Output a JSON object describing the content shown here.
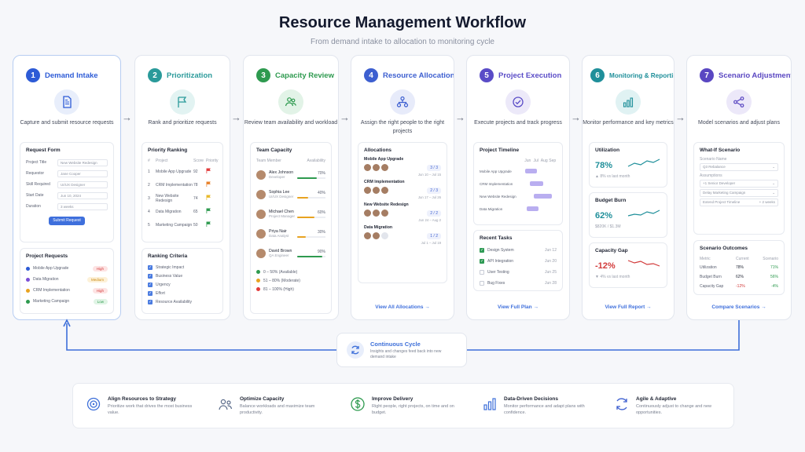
{
  "header": {
    "title": "Resource Management Workflow",
    "subtitle": "From demand intake to allocation to monitoring cycle"
  },
  "stages": [
    {
      "num": "1",
      "title": "Demand Intake",
      "color": "#2d5bd6",
      "desc": "Capture and submit resource requests"
    },
    {
      "num": "2",
      "title": "Prioritization",
      "color": "#2a9a9a",
      "desc": "Rank and prioritize requests"
    },
    {
      "num": "3",
      "title": "Capacity Review",
      "color": "#2e9a4f",
      "desc": "Review team availability and workload"
    },
    {
      "num": "4",
      "title": "Resource Allocation",
      "color": "#3d5fd0",
      "desc": "Assign the right people to the right projects"
    },
    {
      "num": "5",
      "title": "Project Execution",
      "color": "#5a4cc7",
      "desc": "Execute projects and track progress"
    },
    {
      "num": "6",
      "title": "Monitoring & Reporting",
      "color": "#1f8f9a",
      "desc": "Monitor performance and key metrics"
    },
    {
      "num": "7",
      "title": "Scenario Adjustments",
      "color": "#5a47c2",
      "desc": "Model scenarios and adjust plans"
    }
  ],
  "intake": {
    "form_title": "Request Form",
    "fields": [
      {
        "label": "Project Title",
        "value": "New Website Redesign"
      },
      {
        "label": "Requestor",
        "value": "Jane Cooper"
      },
      {
        "label": "Skill Required",
        "value": "UI/UX Designer"
      },
      {
        "label": "Start Date",
        "value": "Jun 10, 2024"
      },
      {
        "label": "Duration",
        "value": "3 weeks"
      }
    ],
    "submit": "Submit Request",
    "requests_title": "Project Requests",
    "requests": [
      {
        "name": "Mobile App Upgrade",
        "dot": "#2d5bd6",
        "tag": "High",
        "tag_bg": "#fde3e3",
        "tag_fg": "#d23a3a"
      },
      {
        "name": "Data Migration",
        "dot": "#7a4fd6",
        "tag": "Medium",
        "tag_bg": "#fdf1d8",
        "tag_fg": "#c98a12"
      },
      {
        "name": "CRM Implementation",
        "dot": "#e8a320",
        "tag": "High",
        "tag_bg": "#fde3e3",
        "tag_fg": "#d23a3a"
      },
      {
        "name": "Marketing Campaign",
        "dot": "#2e9a4f",
        "tag": "Low",
        "tag_bg": "#e0f4e5",
        "tag_fg": "#2e9a4f"
      }
    ]
  },
  "priority": {
    "title": "Priority Ranking",
    "headers": [
      "#",
      "Project",
      "Score",
      "Priority"
    ],
    "rows": [
      {
        "rank": "1",
        "project": "Mobile App Upgrade",
        "score": "92",
        "flag": "#e23b3b"
      },
      {
        "rank": "2",
        "project": "CRM Implementation",
        "score": "78",
        "flag": "#e8812a"
      },
      {
        "rank": "3",
        "project": "New Website Redesign",
        "score": "74",
        "flag": "#e8b92a"
      },
      {
        "rank": "4",
        "project": "Data Migration",
        "score": "65",
        "flag": "#2e9a4f"
      },
      {
        "rank": "5",
        "project": "Marketing Campaign",
        "score": "50",
        "flag": "#2e9a4f"
      }
    ],
    "criteria_title": "Ranking Criteria",
    "criteria": [
      "Strategic Impact",
      "Business Value",
      "Urgency",
      "Effort",
      "Resource Availability"
    ]
  },
  "capacity": {
    "title": "Team Capacity",
    "headers": [
      "Team Member",
      "Availability"
    ],
    "members": [
      {
        "name": "Alex Johnson",
        "role": "Developer",
        "pct": "70%",
        "fill": 0.7,
        "color": "#2e9a4f"
      },
      {
        "name": "Sophia Lee",
        "role": "UI/UX Designer",
        "pct": "40%",
        "fill": 0.4,
        "color": "#e8a320"
      },
      {
        "name": "Michael Chen",
        "role": "Project Manager",
        "pct": "60%",
        "fill": 0.6,
        "color": "#e8a320"
      },
      {
        "name": "Priya Nair",
        "role": "Data Analyst",
        "pct": "30%",
        "fill": 0.3,
        "color": "#e8a320"
      },
      {
        "name": "David Brown",
        "role": "QA Engineer",
        "pct": "90%",
        "fill": 0.9,
        "color": "#2e9a4f"
      }
    ],
    "legend": [
      {
        "label": "0 – 50% (Available)",
        "color": "#2e9a4f"
      },
      {
        "label": "51 – 80% (Moderate)",
        "color": "#e8a320"
      },
      {
        "label": "81 – 100% (High)",
        "color": "#e23b3b"
      }
    ]
  },
  "allocation": {
    "title": "Allocations",
    "items": [
      {
        "name": "Mobile App Upgrade",
        "count": "3 / 3",
        "dates": "Jun 10 – Jul 15"
      },
      {
        "name": "CRM Implementation",
        "count": "2 / 3",
        "dates": "Jun 17 – Jul 26"
      },
      {
        "name": "New Website Redesign",
        "count": "2 / 2",
        "dates": "Jun 24 – Aug 2"
      },
      {
        "name": "Data Migration",
        "count": "1 / 2",
        "dates": "Jul 1 – Jul 19"
      }
    ],
    "link": "View All Allocations →"
  },
  "execution": {
    "timeline_title": "Project Timeline",
    "months": [
      "Jun",
      "Jul",
      "Aug",
      "Sep"
    ],
    "tasks_gantt": [
      {
        "name": "Mobile App Upgrade",
        "start": 0.05,
        "end": 0.4
      },
      {
        "name": "CRM Implementation",
        "start": 0.2,
        "end": 0.6
      },
      {
        "name": "New Website Redesign",
        "start": 0.3,
        "end": 0.85
      },
      {
        "name": "Data Migration",
        "start": 0.1,
        "end": 0.45
      }
    ],
    "tasks_title": "Recent Tasks",
    "tasks": [
      {
        "name": "Design System",
        "date": "Jun 12",
        "done": true
      },
      {
        "name": "API Integration",
        "date": "Jun 20",
        "done": true
      },
      {
        "name": "User Testing",
        "date": "Jun 25",
        "done": false
      },
      {
        "name": "Bug Fixes",
        "date": "Jun 28",
        "done": false
      }
    ],
    "link": "View Full Plan →"
  },
  "monitoring": {
    "cards": [
      {
        "label": "Utilization",
        "value": "78%",
        "sub": "▲ 8% vs last month",
        "color": "#1f8f9a"
      },
      {
        "label": "Budget Burn",
        "value": "62%",
        "sub": "$820K / $1.3M",
        "color": "#1f8f9a"
      },
      {
        "label": "Capacity Gap",
        "value": "-12%",
        "sub": "▼ 4% vs last month",
        "color": "#d23a3a"
      }
    ],
    "link": "View Full Report →"
  },
  "scenario": {
    "title": "What-If Scenario",
    "fields": [
      {
        "label": "Scenario Name",
        "value": "Q3 Rebalance"
      },
      {
        "label": "Assumptions",
        "value": "+1 Senior Developer"
      },
      {
        "label": "",
        "value": "Delay Marketing Campaign"
      },
      {
        "label": "",
        "value": "Extend Project Timeline"
      }
    ],
    "extend_value": "+ 2 weeks",
    "outcomes_title": "Scenario Outcomes",
    "headers": [
      "Metric",
      "Current",
      "Scenario"
    ],
    "outcomes": [
      {
        "metric": "Utilization",
        "current": "78%",
        "scenario": "71%",
        "ccolor": "#1f2433",
        "scolor": "#2e9a4f"
      },
      {
        "metric": "Budget Burn",
        "current": "62%",
        "scenario": "56%",
        "ccolor": "#1f2433",
        "scolor": "#2e9a4f"
      },
      {
        "metric": "Capacity Gap",
        "current": "-12%",
        "scenario": "-4%",
        "ccolor": "#d23a3a",
        "scolor": "#2e9a4f"
      }
    ],
    "link": "Compare Scenarios →"
  },
  "cycle": {
    "title": "Continuous Cycle",
    "desc": "Insights and changes feed back into new demand intake"
  },
  "benefits": [
    {
      "title": "Align Resources to Strategy",
      "desc": "Prioritize work that drives the most business value.",
      "icon": "target-icon",
      "color": "#3d6fd9"
    },
    {
      "title": "Optimize Capacity",
      "desc": "Balance workloads and maximize team productivity.",
      "icon": "team-icon",
      "color": "#5a6b8a"
    },
    {
      "title": "Improve Delivery",
      "desc": "Right people, right projects, on time and on budget.",
      "icon": "dollar-icon",
      "color": "#2e9a4f"
    },
    {
      "title": "Data-Driven Decisions",
      "desc": "Monitor performance and adapt plans with confidence.",
      "icon": "chart-icon",
      "color": "#3d6fd9"
    },
    {
      "title": "Agile & Adaptive",
      "desc": "Continuously adjust to change and new opportunities.",
      "icon": "refresh-icon",
      "color": "#3d5fd0"
    }
  ]
}
